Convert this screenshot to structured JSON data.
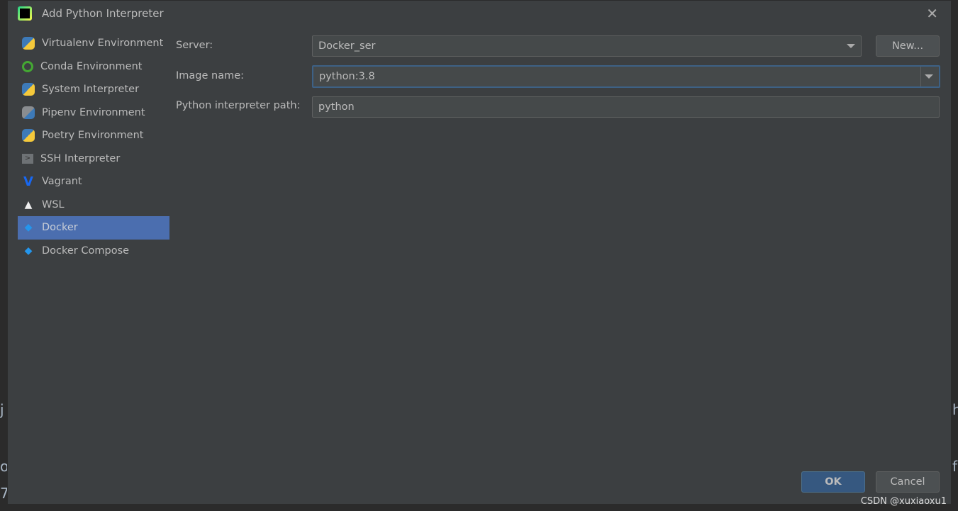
{
  "dialog": {
    "title": "Add Python Interpreter",
    "close_icon": "close-icon"
  },
  "sidebar": {
    "items": [
      {
        "label": "Virtualenv Environment",
        "icon": "python-virtualenv-icon"
      },
      {
        "label": "Conda Environment",
        "icon": "conda-icon"
      },
      {
        "label": "System Interpreter",
        "icon": "python-icon"
      },
      {
        "label": "Pipenv Environment",
        "icon": "pipenv-icon"
      },
      {
        "label": "Poetry Environment",
        "icon": "poetry-icon"
      },
      {
        "label": "SSH Interpreter",
        "icon": "ssh-terminal-icon"
      },
      {
        "label": "Vagrant",
        "icon": "vagrant-icon"
      },
      {
        "label": "WSL",
        "icon": "linux-penguin-icon"
      },
      {
        "label": "Docker",
        "icon": "docker-icon",
        "selected": true
      },
      {
        "label": "Docker Compose",
        "icon": "docker-icon"
      }
    ]
  },
  "form": {
    "server_label": "Server:",
    "server_value": "Docker_ser",
    "new_button": "New...",
    "image_label": "Image name:",
    "image_value": "python:3.8",
    "path_label": "Python interpreter path:",
    "path_value": "python"
  },
  "footer": {
    "ok": "OK",
    "cancel": "Cancel"
  },
  "background": {
    "left": [
      "j",
      "o",
      "7"
    ],
    "right": [
      "h",
      "f"
    ]
  },
  "watermark": "CSDN @xuxiaoxu1",
  "colors": {
    "selection": "#4b6eaf",
    "ok_button": "#365880",
    "dialog_bg": "#3c3f41"
  }
}
